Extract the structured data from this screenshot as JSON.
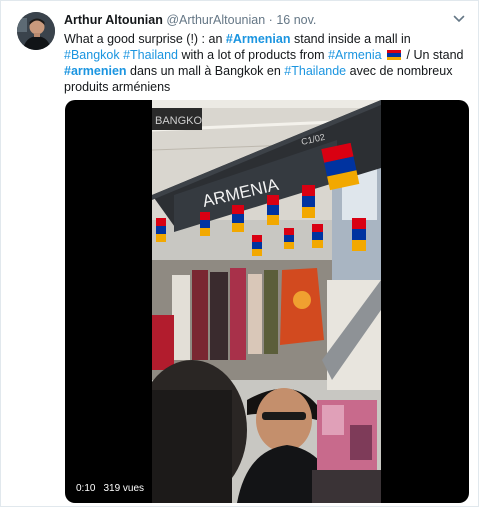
{
  "tweet": {
    "author_name": "Arthur Altounian",
    "handle": "@ArthurAltounian",
    "separator": "·",
    "date": "16 nov.",
    "text": {
      "p1": "What a good surprise (!) : an ",
      "h1": "#Armenian",
      "p2": " stand inside a mall in ",
      "h2": "#Bangkok",
      "p3": " ",
      "h3": "#Thailand",
      "p4": " with a lot of products from ",
      "h4": "#Armenia",
      "p5": "  / Un stand ",
      "h5": "#armenien",
      "p6": " dans un mall à Bangkok en ",
      "h6": "#Thailande",
      "p7": " avec de nombreux produits arméniens"
    },
    "flag_icon": "flag-armenia-icon",
    "video": {
      "sign_text": "ARMENIA",
      "stand_code": "C1/02",
      "mall_sign": "BANGKO",
      "duration": "0:10",
      "views": "319 vues"
    }
  },
  "colors": {
    "link": "#1b95e0",
    "text": "#14171a",
    "muted": "#657786",
    "flag_red": "#d90012",
    "flag_blue": "#0033a0",
    "flag_orange": "#f2a800"
  }
}
